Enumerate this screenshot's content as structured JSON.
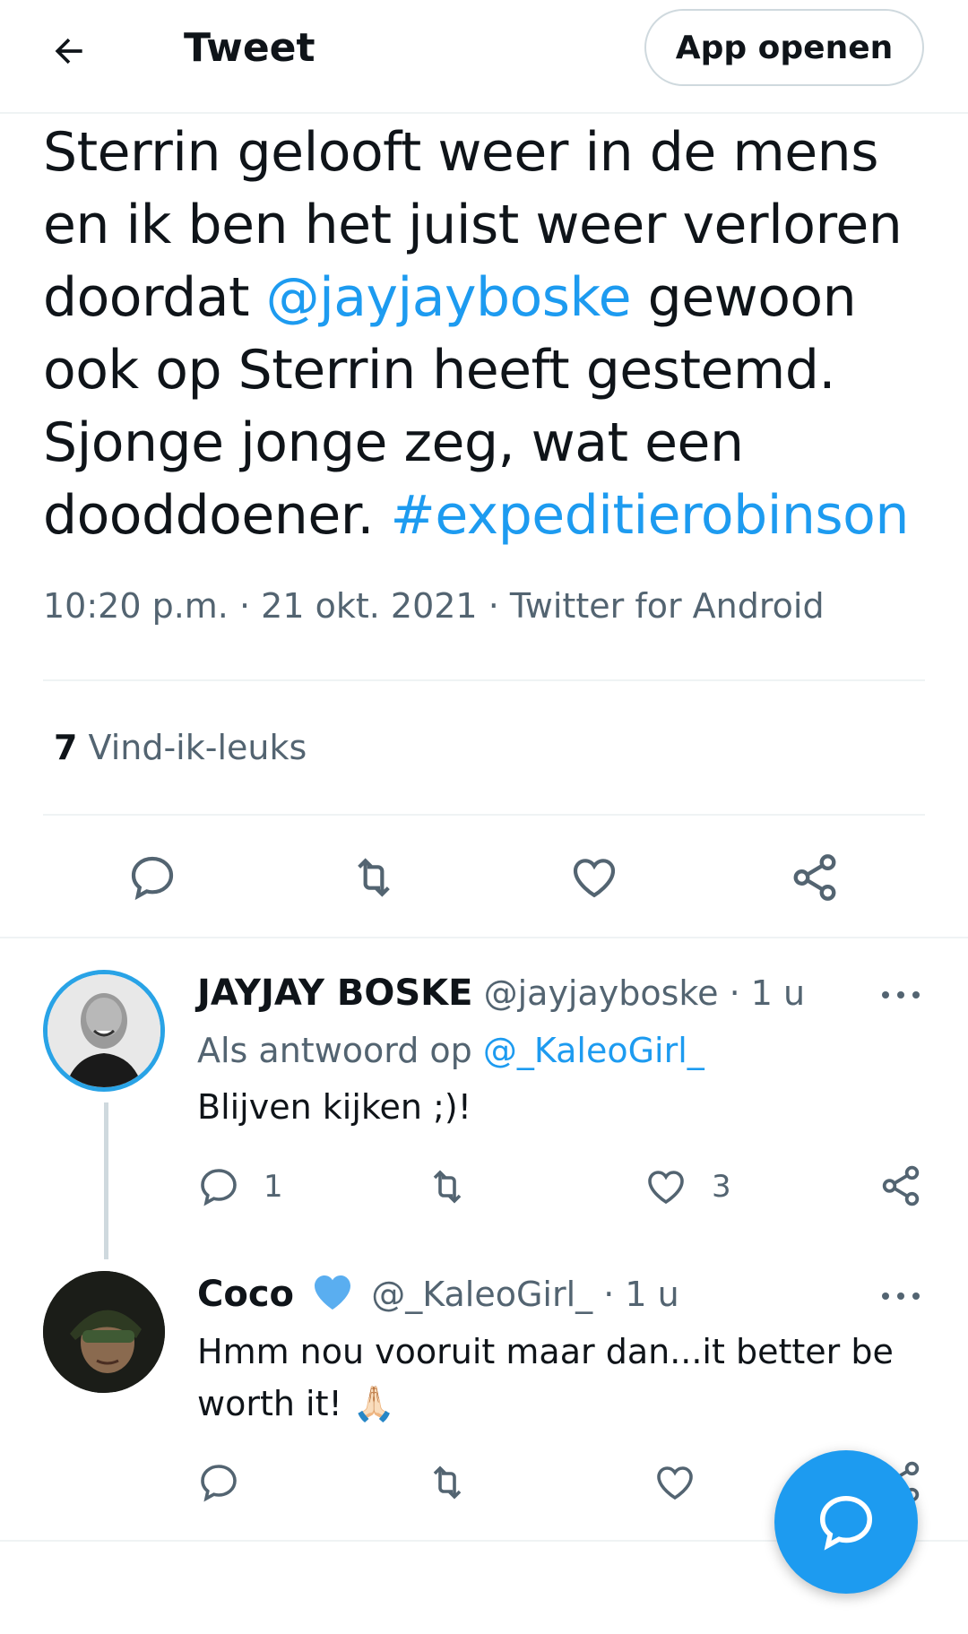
{
  "header": {
    "title": "Tweet",
    "open_app": "App openen"
  },
  "tweet": {
    "text_parts": [
      {
        "t": "Sterrin gelooft weer in de mens en ik ben het juist weer verloren doordat "
      },
      {
        "t": "@jayjayboske",
        "link": true
      },
      {
        "t": " gewoon ook op Sterrin heeft gestemd. Sjonge jonge zeg, wat een dooddoener. "
      },
      {
        "t": "#expeditierobinson",
        "link": true
      }
    ],
    "time": "10:20 p.m.",
    "date": "21 okt. 2021",
    "source": "Twitter for Android",
    "likes_count": "7",
    "likes_label": "Vind-ik-leuks"
  },
  "replies": [
    {
      "name": "JAYJAY BOSKE",
      "handle": "@jayjayboske",
      "time": "1 u",
      "reply_to_prefix": "Als antwoord op ",
      "reply_to_handle": "@_KaleoGirl_",
      "text": "Blijven kijken ;)!",
      "reply_count": "1",
      "like_count": "3"
    },
    {
      "name": "Coco",
      "handle": "@_KaleoGirl_",
      "time": "1 u",
      "text_line1": "Hmm nou vooruit maar dan...it better be",
      "text_line2": "worth it! 🙏🏻",
      "verified_heart_color": "#1d9bf0"
    }
  ],
  "colors": {
    "accent": "#1d9bf0",
    "muted": "#536471",
    "text": "#0f1419"
  },
  "icons": [
    "back-arrow-icon",
    "reply-icon",
    "retweet-icon",
    "like-icon",
    "share-icon",
    "more-icon",
    "compose-icon"
  ]
}
